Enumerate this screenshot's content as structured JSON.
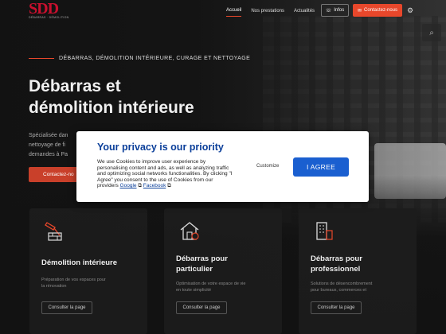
{
  "header": {
    "logo_text": "SDD",
    "logo_tagline": "DÉBARRAS · DÉMOLITION",
    "nav": [
      {
        "label": "Accueil",
        "active": true
      },
      {
        "label": "Nos prestations",
        "active": false
      },
      {
        "label": "Actualités",
        "active": false
      }
    ],
    "info_label": "Infos",
    "contact_label": "Contactez-nous",
    "accent_color": "#e8472b",
    "logo_color": "#c8102e"
  },
  "hero": {
    "kicker": "DÉBARRAS, DÉMOLITION INTÉRIEURE, CURAGE ET NETTOYAGE",
    "title_line1": "Débarras et",
    "title_line2": "démolition intérieure",
    "intro_line1": "Spécialisée dan",
    "intro_line2": "nettoyage de fi",
    "intro_line3": "demandes à Pa",
    "cta_label": "Contactez-no"
  },
  "cards": [
    {
      "icon": "demolition-icon",
      "title_line1": "Démolition intérieure",
      "title_line2": "",
      "desc_line1": "Préparation de vos espaces pour",
      "desc_line2": "la rénovation",
      "button": "Consulter la page"
    },
    {
      "icon": "house-icon",
      "title_line1": "Débarras pour",
      "title_line2": "particulier",
      "desc_line1": "Optimisation de votre espace de vie",
      "desc_line2": "en toute simplicité",
      "button": "Consulter la page"
    },
    {
      "icon": "building-icon",
      "title_line1": "Débarras pour",
      "title_line2": "professionnel",
      "desc_line1": "Solutions de désencombrement",
      "desc_line2": "pour bureaux, commerces et",
      "button": "Consulter la page"
    }
  ],
  "cookie": {
    "title": "Your privacy is our priority",
    "text": "We use Cookies to improve user experience by personalising content and ads, as well as analyzing traffic and optimizing social networks functionalities. By clicking \"I Agree\" you consent to the use of Cookies from our providers",
    "link_google": "Google",
    "link_facebook": "Facebook",
    "customize_label": "Customize",
    "agree_label": "I AGREE",
    "title_color": "#0b3f9a",
    "button_color": "#1a5fd0"
  }
}
